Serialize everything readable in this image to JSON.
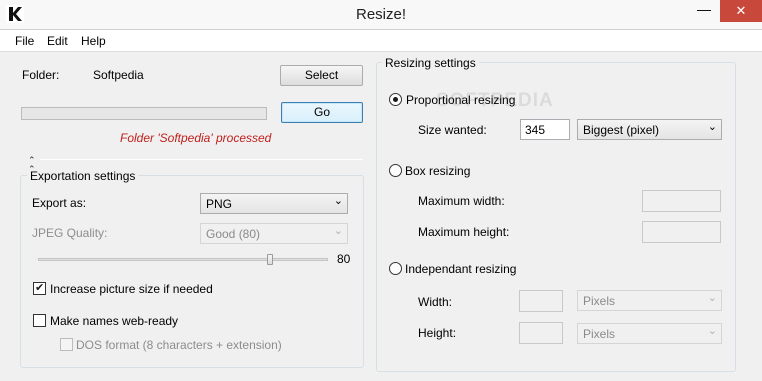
{
  "window": {
    "title": "Resize!",
    "app_icon": "k-app-icon",
    "minimize_glyph": "—",
    "close_glyph": "✕"
  },
  "menu": [
    "File",
    "Edit",
    "Help"
  ],
  "folder": {
    "label": "Folder:",
    "value": "Softpedia",
    "select_button": "Select"
  },
  "progress": {
    "fraction": 0
  },
  "go_button": "Go",
  "status_text": "Folder 'Softpedia' processed",
  "exportation": {
    "title": "Exportation settings",
    "export_as_label": "Export as:",
    "export_as_value": "PNG",
    "jpeg_quality_label": "JPEG Quality:",
    "jpeg_quality_value": "Good (80)",
    "quality_slider": {
      "min": 0,
      "max": 100,
      "value": 80
    },
    "quality_number": "80",
    "increase_size_label": "Increase picture size if needed",
    "increase_size_checked": true,
    "web_ready_label": "Make names web-ready",
    "web_ready_checked": false,
    "dos_format_label": "DOS format (8 characters + extension)",
    "dos_format_checked": false
  },
  "resizing": {
    "title": "Resizing settings",
    "proportional_label": "Proportional resizing",
    "size_wanted_label": "Size wanted:",
    "size_wanted_value": "345",
    "size_mode_value": "Biggest (pixel)",
    "box_label": "Box resizing",
    "max_width_label": "Maximum width:",
    "max_width_value": "",
    "max_height_label": "Maximum height:",
    "max_height_value": "",
    "independent_label": "Independant resizing",
    "width_label": "Width:",
    "width_value": "",
    "width_unit": "Pixels",
    "height_label": "Height:",
    "height_value": "",
    "height_unit": "Pixels",
    "selected_mode": "proportional"
  },
  "watermark": "SOFTPEDIA",
  "colors": {
    "status_text": "#c0201e",
    "close_button": "#c9483c",
    "focus_border": "#3c7fb1"
  }
}
